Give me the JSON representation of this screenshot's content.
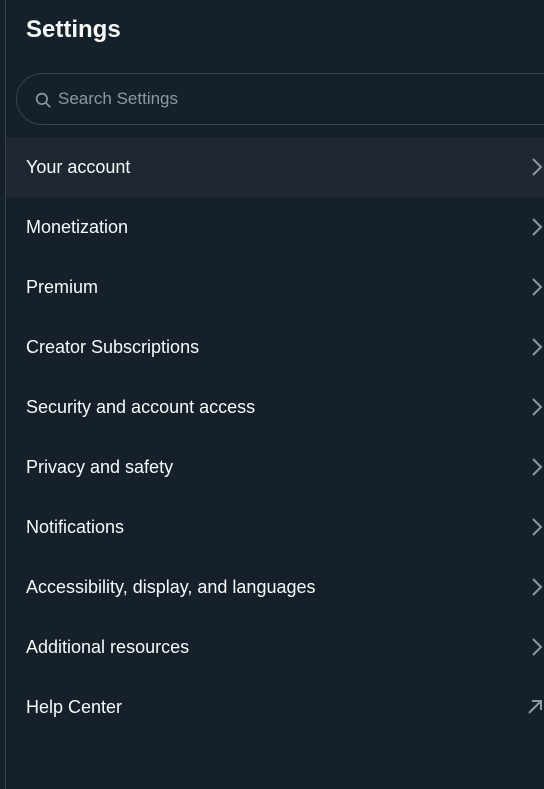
{
  "header": {
    "title": "Settings"
  },
  "search": {
    "placeholder": "Search Settings",
    "icon": "search-icon"
  },
  "menu": {
    "items": [
      {
        "label": "Your account",
        "icon": "chevron-right-icon",
        "active": true
      },
      {
        "label": "Monetization",
        "icon": "chevron-right-icon"
      },
      {
        "label": "Premium",
        "icon": "chevron-right-icon"
      },
      {
        "label": "Creator Subscriptions",
        "icon": "chevron-right-icon"
      },
      {
        "label": "Security and account access",
        "icon": "chevron-right-icon"
      },
      {
        "label": "Privacy and safety",
        "icon": "chevron-right-icon"
      },
      {
        "label": "Notifications",
        "icon": "chevron-right-icon"
      },
      {
        "label": "Accessibility, display, and languages",
        "icon": "chevron-right-icon"
      },
      {
        "label": "Additional resources",
        "icon": "chevron-right-icon"
      },
      {
        "label": "Help Center",
        "icon": "external-link-icon"
      }
    ]
  },
  "colors": {
    "background": "#15202b",
    "active_row": "#1e2732",
    "text": "#f7f9f9",
    "muted": "#8b98a5",
    "border": "#38444d"
  }
}
